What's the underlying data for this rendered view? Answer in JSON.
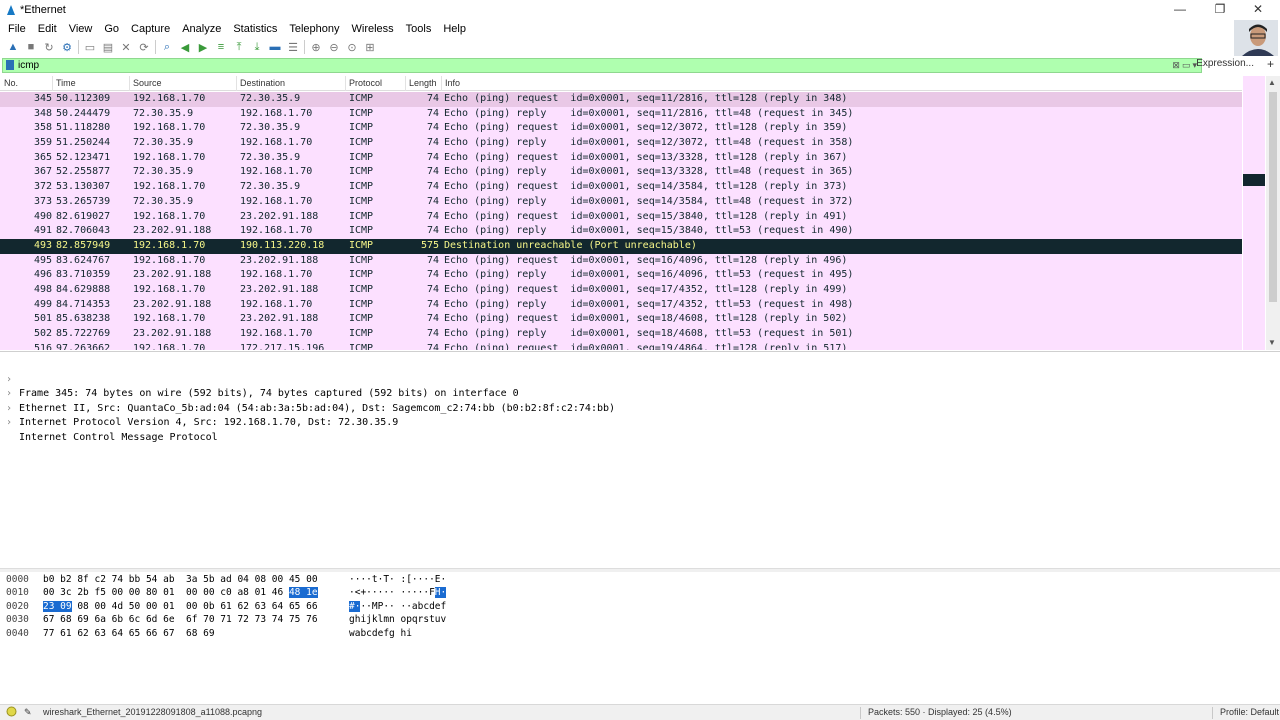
{
  "window": {
    "title": "*Ethernet",
    "minimize": "—",
    "restore": "❐",
    "close": "✕"
  },
  "menu": [
    "File",
    "Edit",
    "View",
    "Go",
    "Capture",
    "Analyze",
    "Statistics",
    "Telephony",
    "Wireless",
    "Tools",
    "Help"
  ],
  "filter": {
    "value": "icmp",
    "expression_label": "Expression...",
    "add_label": "+"
  },
  "columns": {
    "no": "No.",
    "time": "Time",
    "source": "Source",
    "destination": "Destination",
    "protocol": "Protocol",
    "length": "Length",
    "info": "Info"
  },
  "packets": [
    {
      "no": "345",
      "time": "50.112309",
      "src": "192.168.1.70",
      "dst": "72.30.35.9",
      "proto": "ICMP",
      "len": "74",
      "info": "Echo (ping) request  id=0x0001, seq=11/2816, ttl=128 (reply in 348)"
    },
    {
      "no": "348",
      "time": "50.244479",
      "src": "72.30.35.9",
      "dst": "192.168.1.70",
      "proto": "ICMP",
      "len": "74",
      "info": "Echo (ping) reply    id=0x0001, seq=11/2816, ttl=48 (request in 345)"
    },
    {
      "no": "358",
      "time": "51.118280",
      "src": "192.168.1.70",
      "dst": "72.30.35.9",
      "proto": "ICMP",
      "len": "74",
      "info": "Echo (ping) request  id=0x0001, seq=12/3072, ttl=128 (reply in 359)"
    },
    {
      "no": "359",
      "time": "51.250244",
      "src": "72.30.35.9",
      "dst": "192.168.1.70",
      "proto": "ICMP",
      "len": "74",
      "info": "Echo (ping) reply    id=0x0001, seq=12/3072, ttl=48 (request in 358)"
    },
    {
      "no": "365",
      "time": "52.123471",
      "src": "192.168.1.70",
      "dst": "72.30.35.9",
      "proto": "ICMP",
      "len": "74",
      "info": "Echo (ping) request  id=0x0001, seq=13/3328, ttl=128 (reply in 367)"
    },
    {
      "no": "367",
      "time": "52.255877",
      "src": "72.30.35.9",
      "dst": "192.168.1.70",
      "proto": "ICMP",
      "len": "74",
      "info": "Echo (ping) reply    id=0x0001, seq=13/3328, ttl=48 (request in 365)"
    },
    {
      "no": "372",
      "time": "53.130307",
      "src": "192.168.1.70",
      "dst": "72.30.35.9",
      "proto": "ICMP",
      "len": "74",
      "info": "Echo (ping) request  id=0x0001, seq=14/3584, ttl=128 (reply in 373)"
    },
    {
      "no": "373",
      "time": "53.265739",
      "src": "72.30.35.9",
      "dst": "192.168.1.70",
      "proto": "ICMP",
      "len": "74",
      "info": "Echo (ping) reply    id=0x0001, seq=14/3584, ttl=48 (request in 372)"
    },
    {
      "no": "490",
      "time": "82.619027",
      "src": "192.168.1.70",
      "dst": "23.202.91.188",
      "proto": "ICMP",
      "len": "74",
      "info": "Echo (ping) request  id=0x0001, seq=15/3840, ttl=128 (reply in 491)"
    },
    {
      "no": "491",
      "time": "82.706043",
      "src": "23.202.91.188",
      "dst": "192.168.1.70",
      "proto": "ICMP",
      "len": "74",
      "info": "Echo (ping) reply    id=0x0001, seq=15/3840, ttl=53 (request in 490)"
    },
    {
      "no": "493",
      "time": "82.857949",
      "src": "192.168.1.70",
      "dst": "190.113.220.18",
      "proto": "ICMP",
      "len": "575",
      "info": "Destination unreachable (Port unreachable)"
    },
    {
      "no": "495",
      "time": "83.624767",
      "src": "192.168.1.70",
      "dst": "23.202.91.188",
      "proto": "ICMP",
      "len": "74",
      "info": "Echo (ping) request  id=0x0001, seq=16/4096, ttl=128 (reply in 496)"
    },
    {
      "no": "496",
      "time": "83.710359",
      "src": "23.202.91.188",
      "dst": "192.168.1.70",
      "proto": "ICMP",
      "len": "74",
      "info": "Echo (ping) reply    id=0x0001, seq=16/4096, ttl=53 (request in 495)"
    },
    {
      "no": "498",
      "time": "84.629888",
      "src": "192.168.1.70",
      "dst": "23.202.91.188",
      "proto": "ICMP",
      "len": "74",
      "info": "Echo (ping) request  id=0x0001, seq=17/4352, ttl=128 (reply in 499)"
    },
    {
      "no": "499",
      "time": "84.714353",
      "src": "23.202.91.188",
      "dst": "192.168.1.70",
      "proto": "ICMP",
      "len": "74",
      "info": "Echo (ping) reply    id=0x0001, seq=17/4352, ttl=53 (request in 498)"
    },
    {
      "no": "501",
      "time": "85.638238",
      "src": "192.168.1.70",
      "dst": "23.202.91.188",
      "proto": "ICMP",
      "len": "74",
      "info": "Echo (ping) request  id=0x0001, seq=18/4608, ttl=128 (reply in 502)"
    },
    {
      "no": "502",
      "time": "85.722769",
      "src": "23.202.91.188",
      "dst": "192.168.1.70",
      "proto": "ICMP",
      "len": "74",
      "info": "Echo (ping) reply    id=0x0001, seq=18/4608, ttl=53 (request in 501)"
    },
    {
      "no": "516",
      "time": "97.263662",
      "src": "192.168.1.70",
      "dst": "172.217.15.196",
      "proto": "ICMP",
      "len": "74",
      "info": "Echo (ping) request  id=0x0001, seq=19/4864, ttl=128 (reply in 517)"
    }
  ],
  "details": [
    "Frame 345: 74 bytes on wire (592 bits), 74 bytes captured (592 bits) on interface 0",
    "Ethernet II, Src: QuantaCo_5b:ad:04 (54:ab:3a:5b:ad:04), Dst: Sagemcom_c2:74:bb (b0:b2:8f:c2:74:bb)",
    "Internet Protocol Version 4, Src: 192.168.1.70, Dst: 72.30.35.9",
    "Internet Control Message Protocol"
  ],
  "bytes": [
    {
      "off": "0000",
      "hex_a": "b0 b2 8f c2 74 bb 54 ab  3a 5b ad 04 08 00 45 00",
      "hex_b": "",
      "hex_c": "",
      "ascii_a": "····t·T· :[····E·",
      "ascii_b": "",
      "ascii_c": ""
    },
    {
      "off": "0010",
      "hex_a": "00 3c 2b f5 00 00 80 01  00 00 c0 a8 01 46 ",
      "hex_b": "48 1e",
      "hex_c": "",
      "ascii_a": "·<+····· ·····F",
      "ascii_b": "H·",
      "ascii_c": ""
    },
    {
      "off": "0020",
      "hex_a": "",
      "hex_b": "23 09",
      "hex_c": " 08 00 4d 50 00 01  00 0b 61 62 63 64 65 66",
      "ascii_a": "",
      "ascii_b": "#·",
      "ascii_c": "··MP·· ··abcdef"
    },
    {
      "off": "0030",
      "hex_a": "67 68 69 6a 6b 6c 6d 6e  6f 70 71 72 73 74 75 76",
      "hex_b": "",
      "hex_c": "",
      "ascii_a": "ghijklmn opqrstuv",
      "ascii_b": "",
      "ascii_c": ""
    },
    {
      "off": "0040",
      "hex_a": "77 61 62 63 64 65 66 67  68 69",
      "hex_b": "",
      "hex_c": "",
      "ascii_a": "wabcdefg hi",
      "ascii_b": "",
      "ascii_c": ""
    }
  ],
  "status": {
    "file": "wireshark_Ethernet_20191228091808_a11088.pcapng",
    "packets": "Packets: 550 · Displayed: 25 (4.5%)",
    "profile": "Profile: Default"
  }
}
